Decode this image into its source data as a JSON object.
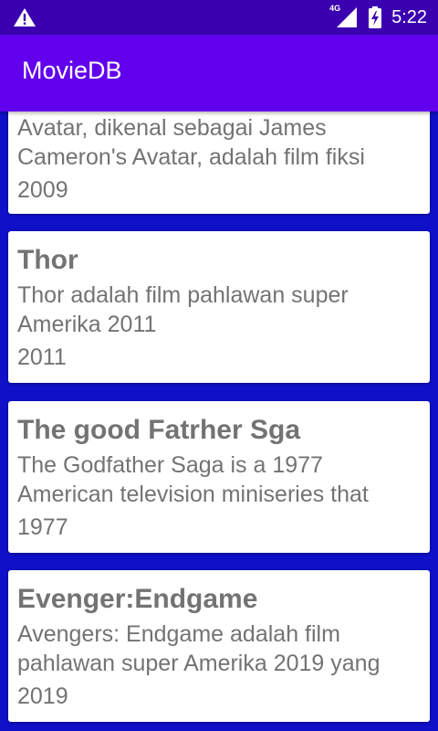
{
  "status_bar": {
    "alert_icon": "warning-icon",
    "network_label": "4G",
    "signal_icon": "signal-icon",
    "battery_icon": "battery-charging-icon",
    "time": "5:22"
  },
  "app_bar": {
    "title": "MovieDB"
  },
  "colors": {
    "status_bar": "#3a00b0",
    "app_bar": "#6200ee",
    "background": "#1010c8",
    "card": "#ffffff",
    "card_text": "#737373"
  },
  "movies": [
    {
      "title": "",
      "description": "Avatar, dikenal sebagai James Cameron's Avatar, adalah film fiksi",
      "year": "2009"
    },
    {
      "title": "Thor",
      "description": "Thor adalah film pahlawan super Amerika 2011",
      "year": "2011"
    },
    {
      "title": "The good Fatrher Sga",
      "description": "The Godfather Saga is a 1977 American television miniseries that",
      "year": "1977"
    },
    {
      "title": "Evenger:Endgame",
      "description": "Avengers: Endgame adalah film pahlawan super Amerika 2019 yang",
      "year": "2019"
    }
  ]
}
